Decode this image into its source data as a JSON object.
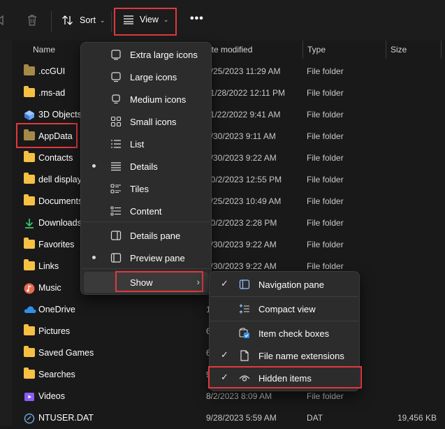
{
  "toolbar": {
    "sort_label": "Sort",
    "view_label": "View",
    "more_label": "..."
  },
  "columns": {
    "name": "Name",
    "date": "Date modified",
    "type": "Type",
    "size": "Size"
  },
  "rows": [
    {
      "name": ".ccGUI",
      "date": "9/25/2023 11:29 AM",
      "type": "File folder",
      "size": "",
      "icon": "folder-dim"
    },
    {
      "name": ".ms-ad",
      "date": "11/28/2022 12:11 PM",
      "type": "File folder",
      "size": "",
      "icon": "folder"
    },
    {
      "name": "3D Objects",
      "date": "11/22/2022 9:41 AM",
      "type": "File folder",
      "size": "",
      "icon": "3d-objects"
    },
    {
      "name": "AppData",
      "date": "9/30/2023 9:11 AM",
      "type": "File folder",
      "size": "",
      "icon": "folder-dim"
    },
    {
      "name": "Contacts",
      "date": "9/30/2023 9:22 AM",
      "type": "File folder",
      "size": "",
      "icon": "folder"
    },
    {
      "name": "dell display manager",
      "date": "10/2/2023 12:55 PM",
      "type": "File folder",
      "size": "",
      "icon": "folder"
    },
    {
      "name": "Documents",
      "date": "9/25/2023 10:49 AM",
      "type": "File folder",
      "size": "",
      "icon": "folder"
    },
    {
      "name": "Downloads",
      "date": "10/2/2023 2:28 PM",
      "type": "File folder",
      "size": "",
      "icon": "download"
    },
    {
      "name": "Favorites",
      "date": "9/30/2023 9:22 AM",
      "type": "File folder",
      "size": "",
      "icon": "folder"
    },
    {
      "name": "Links",
      "date": "9/30/2023 9:22 AM",
      "type": "File folder",
      "size": "",
      "icon": "folder"
    },
    {
      "name": "Music",
      "date": "",
      "type": "",
      "size": "",
      "icon": "music"
    },
    {
      "name": "OneDrive",
      "date": "1",
      "type": "",
      "size": "",
      "icon": "onedrive"
    },
    {
      "name": "Pictures",
      "date": "6",
      "type": "",
      "size": "",
      "icon": "folder"
    },
    {
      "name": "Saved Games",
      "date": "6",
      "type": "",
      "size": "",
      "icon": "folder"
    },
    {
      "name": "Searches",
      "date": "9",
      "type": "",
      "size": "",
      "icon": "folder"
    },
    {
      "name": "Videos",
      "date": "8/2/2023 8:09 AM",
      "type": "File folder",
      "size": "",
      "icon": "videos"
    },
    {
      "name": "NTUSER.DAT",
      "date": "9/28/2023 5:59 AM",
      "type": "DAT",
      "size": "19,456 KB",
      "icon": "dat-file"
    }
  ],
  "view_menu": {
    "items": [
      {
        "label": "Extra large icons",
        "selected": false,
        "icon": "extra-large-icons-icon"
      },
      {
        "label": "Large icons",
        "selected": false,
        "icon": "large-icons-icon"
      },
      {
        "label": "Medium icons",
        "selected": false,
        "icon": "medium-icons-icon"
      },
      {
        "label": "Small icons",
        "selected": false,
        "icon": "small-icons-icon"
      },
      {
        "label": "List",
        "selected": false,
        "icon": "list-icon"
      },
      {
        "label": "Details",
        "selected": true,
        "icon": "details-icon"
      },
      {
        "label": "Tiles",
        "selected": false,
        "icon": "tiles-icon"
      },
      {
        "label": "Content",
        "selected": false,
        "icon": "content-icon"
      },
      {
        "label": "Details pane",
        "selected": false,
        "icon": "details-pane-icon"
      },
      {
        "label": "Preview pane",
        "selected": true,
        "icon": "preview-pane-icon"
      }
    ],
    "show_label": "Show"
  },
  "show_menu": {
    "items": [
      {
        "label": "Navigation pane",
        "checked": true,
        "icon": "navigation-pane-icon"
      },
      {
        "label": "Compact view",
        "checked": false,
        "icon": "compact-view-icon"
      },
      {
        "label": "Item check boxes",
        "checked": false,
        "icon": "item-check-boxes-icon"
      },
      {
        "label": "File name extensions",
        "checked": true,
        "icon": "file-extensions-icon"
      },
      {
        "label": "Hidden items",
        "checked": true,
        "icon": "eye-icon"
      }
    ]
  },
  "colors": {
    "highlight": "#e0393e",
    "folder": "#f5c043",
    "accent": "#4cc2ff"
  }
}
